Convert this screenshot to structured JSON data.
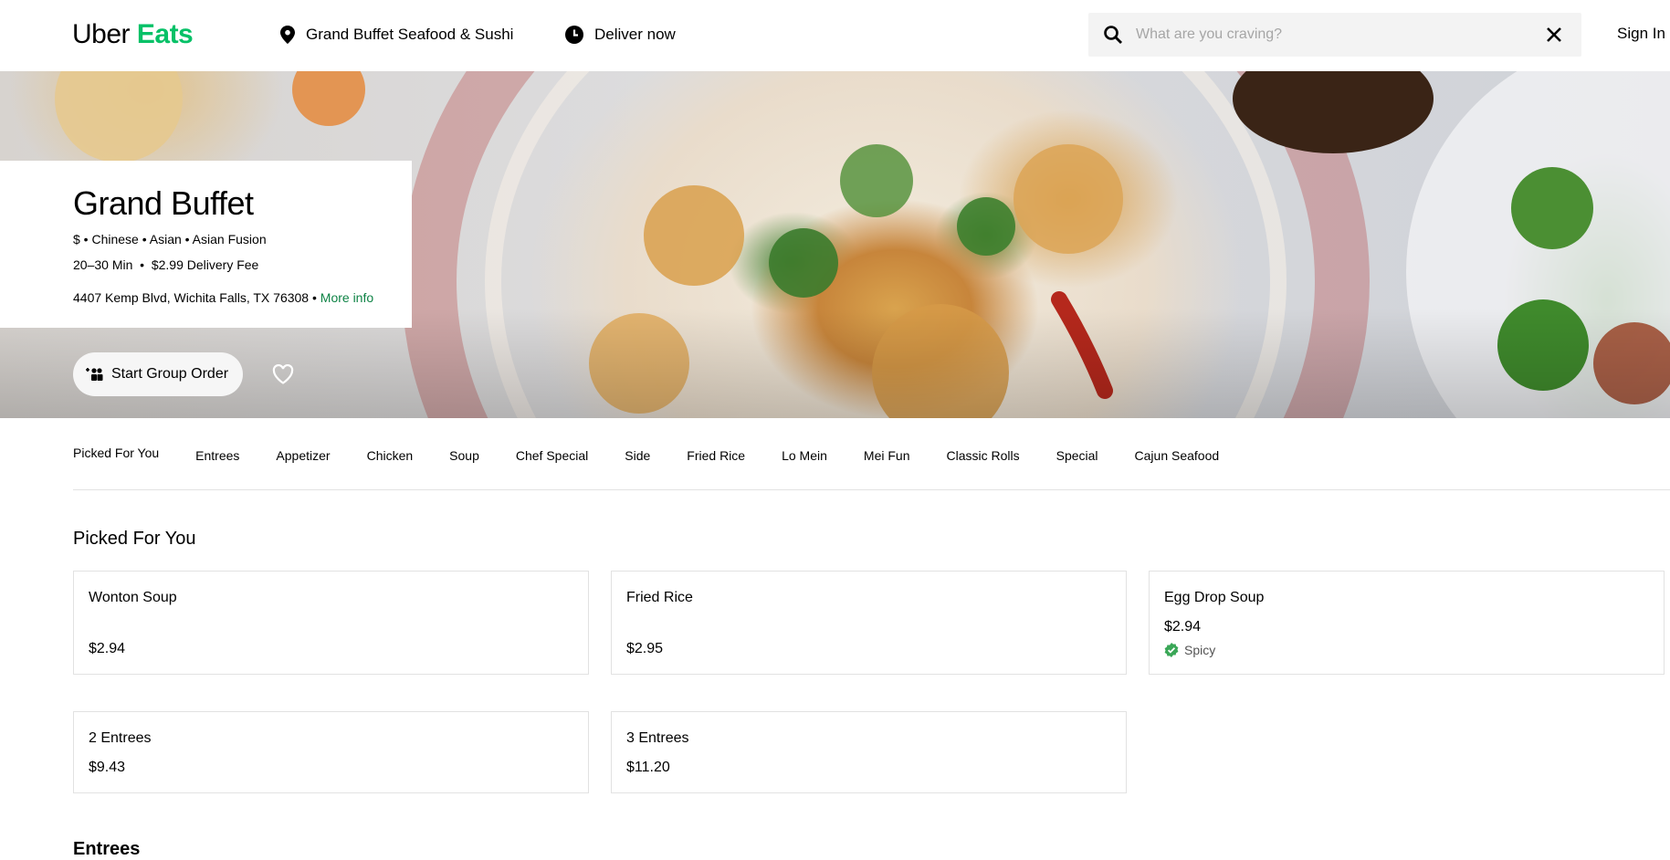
{
  "header": {
    "logo_part1": "Uber",
    "logo_part2": "Eats",
    "location": "Grand Buffet Seafood & Sushi",
    "deliver": "Deliver now",
    "search_placeholder": "What are you craving?",
    "sign_in": "Sign In"
  },
  "restaurant": {
    "name": "Grand Buffet",
    "cuisines": "$ • Chinese • Asian • Asian Fusion",
    "delivery": "20–30 Min  •  $2.99 Delivery Fee",
    "address": "4407 Kemp Blvd, Wichita Falls, TX 76308 •",
    "more_info": "More info",
    "group_order": "Start Group Order"
  },
  "tabs": [
    "Picked For You",
    "Entrees",
    "Appetizer",
    "Chicken",
    "Soup",
    "Chef Special",
    "Side",
    "Fried Rice",
    "Lo Mein",
    "Mei Fun",
    "Classic Rolls",
    "Special",
    "Cajun Seafood"
  ],
  "sections": {
    "picked": "Picked For You",
    "entrees": "Entrees"
  },
  "items": [
    {
      "name": "Wonton Soup",
      "price": "$2.94"
    },
    {
      "name": "Fried Rice",
      "price": "$2.95"
    },
    {
      "name": "Egg Drop Soup",
      "price": "$2.94",
      "tag": "Spicy"
    },
    {
      "name": "2 Entrees",
      "price": "$9.43"
    },
    {
      "name": "3 Entrees",
      "price": "$11.20"
    }
  ],
  "colors": {
    "brand_green": "#06c167",
    "link_green": "#0e8345"
  }
}
